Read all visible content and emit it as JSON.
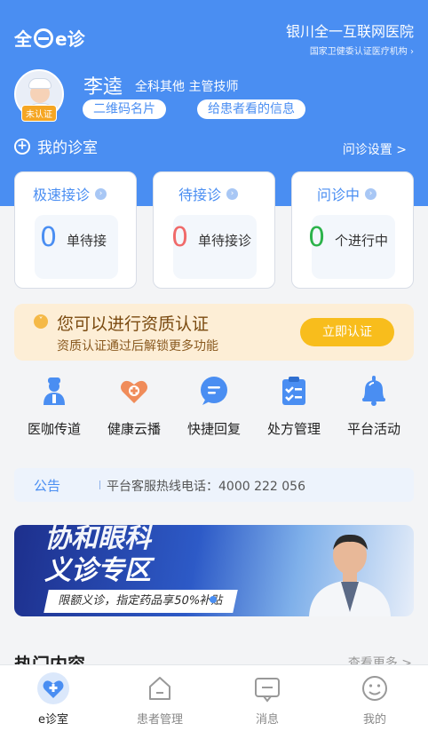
{
  "header": {
    "logo_text_left": "全",
    "logo_text_right": "e诊",
    "hospital_name": "银川全一互联网医院",
    "hospital_sub": "国家卫健委认证医疗机构 ›"
  },
  "doctor": {
    "name": "李逵",
    "department": "全科其他",
    "title": "主管技师",
    "status_badge": "未认证",
    "qr_button": "二维码名片",
    "patient_info_button": "给患者看的信息"
  },
  "room": {
    "title": "我的诊室",
    "settings": "问诊设置 >"
  },
  "cards": [
    {
      "title": "极速接诊",
      "count": "0",
      "label": "单待接",
      "color": "#4a8ef2"
    },
    {
      "title": "待接诊",
      "count": "0",
      "label": "单待接诊",
      "color": "#f06a6a"
    },
    {
      "title": "问诊中",
      "count": "0",
      "label": "个进行中",
      "color": "#2cb34a"
    }
  ],
  "verify": {
    "title": "您可以进行资质认证",
    "subtitle": "资质认证通过后解锁更多功能",
    "button": "立即认证"
  },
  "tools": [
    {
      "label": "医咖传道",
      "icon": "doctor-icon"
    },
    {
      "label": "健康云播",
      "icon": "heart-plus-icon"
    },
    {
      "label": "快捷回复",
      "icon": "chat-icon"
    },
    {
      "label": "处方管理",
      "icon": "clipboard-icon"
    },
    {
      "label": "平台活动",
      "icon": "bell-icon"
    }
  ],
  "notice": {
    "tag": "公告",
    "text": "平台客服热线电话：4000 222 056"
  },
  "banner": {
    "top_text": "协和眼科",
    "title": "义诊专区",
    "subtitle": "限额义诊，指定药品享50%补贴"
  },
  "hot": {
    "title": "热门内容",
    "more": "查看更多 >"
  },
  "tabbar": [
    {
      "label": "e诊室",
      "icon": "heart-plus-icon",
      "active": true
    },
    {
      "label": "患者管理",
      "icon": "home-icon",
      "active": false
    },
    {
      "label": "消息",
      "icon": "message-icon",
      "active": false
    },
    {
      "label": "我的",
      "icon": "smile-face-icon",
      "active": false
    }
  ],
  "colors": {
    "brand_blue": "#4a8ef2",
    "warning_yellow": "#f8bd1c",
    "red": "#f06a6a",
    "green": "#2cb34a"
  }
}
